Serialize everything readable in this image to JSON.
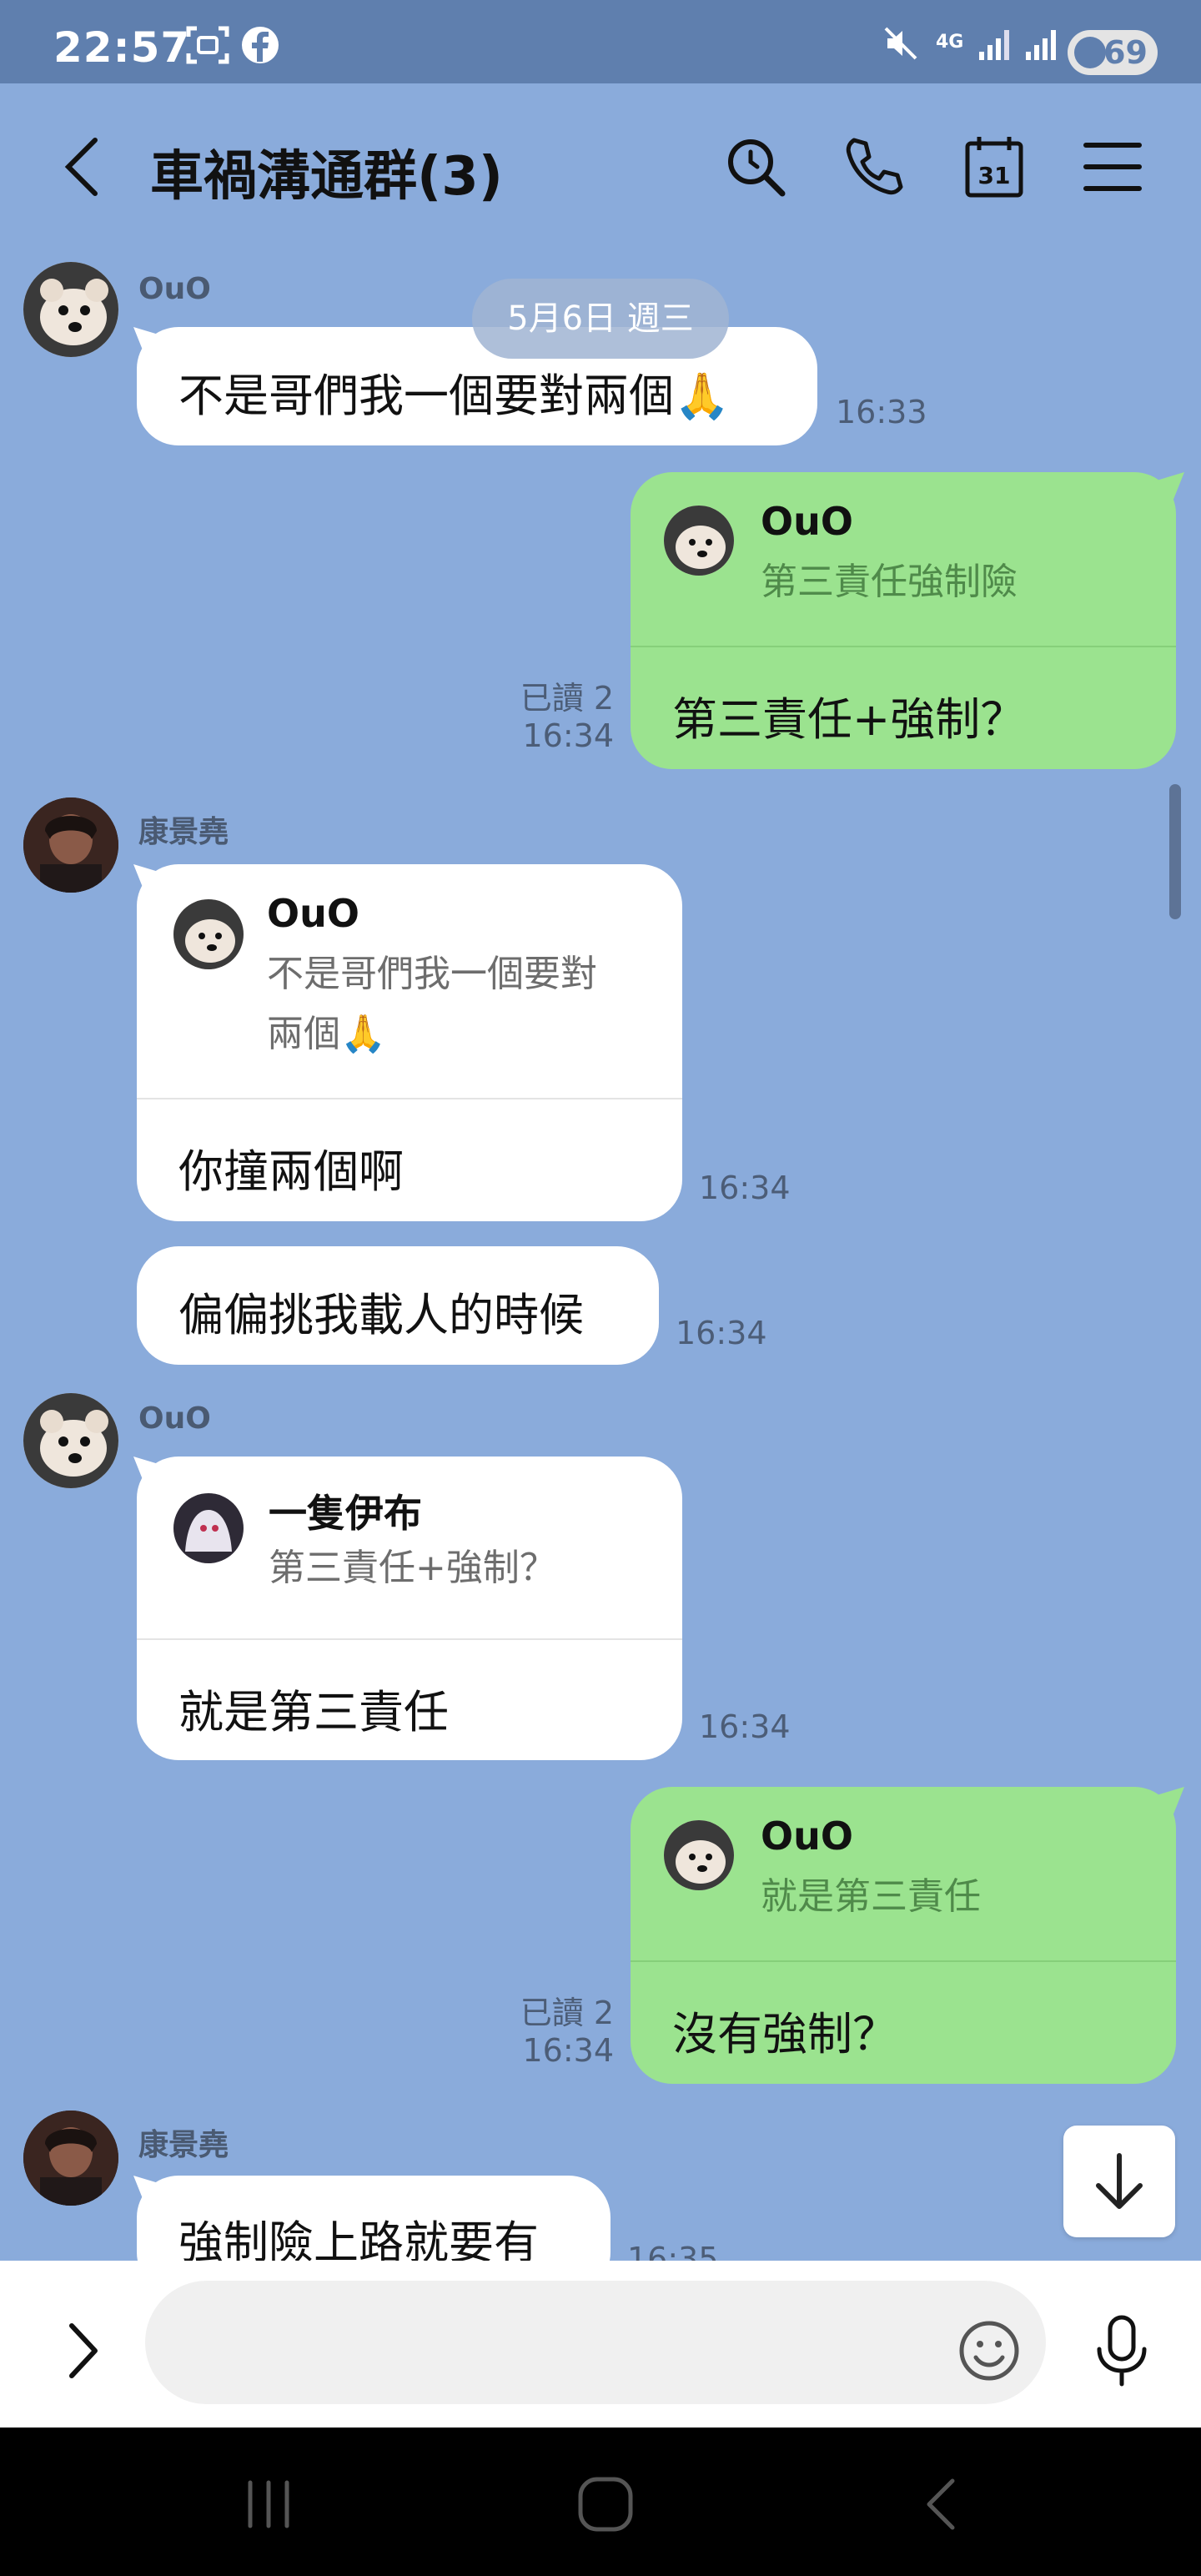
{
  "status_bar": {
    "time": "22:57",
    "network": "4G",
    "battery": "69",
    "icons": [
      "screenshot-icon",
      "facebook-icon",
      "mute-icon",
      "signal-icon",
      "battery-icon"
    ]
  },
  "header": {
    "title": "車禍溝通群(3)",
    "icons": [
      "back-icon",
      "search-icon",
      "call-icon",
      "calendar-icon",
      "menu-icon"
    ],
    "calendar_day": "31"
  },
  "date_chip": "5月6日 週三",
  "messages": [
    {
      "sender": "OuO",
      "text": "不是哥們我一個要對兩個🙏",
      "time": "16:33"
    },
    {
      "side": "right",
      "reply_to": "OuO",
      "reply_quote": "第三責任強制險",
      "text": "第三責任+強制？",
      "read": "已讀 2",
      "time": "16:34"
    },
    {
      "sender": "康景堯",
      "reply_to": "OuO",
      "reply_quote_1": "不是哥們我一個要對",
      "reply_quote_2": "兩個🙏",
      "text": "你撞兩個啊",
      "time": "16:34"
    },
    {
      "text": "偏偏挑我載人的時候",
      "time": "16:34"
    },
    {
      "sender": "OuO",
      "reply_to": "一隻伊布",
      "reply_quote": "第三責任+強制？",
      "text": "就是第三責任",
      "time": "16:34"
    },
    {
      "side": "right",
      "reply_to": "OuO",
      "reply_quote": "就是第三責任",
      "text": "沒有強制？",
      "read": "已讀 2",
      "time": "16:34"
    },
    {
      "sender": "康景堯",
      "text": "強制險上路就要有",
      "time": "16:35"
    }
  ],
  "colors": {
    "chat_background": "#8aabdb",
    "status_bar": "#5f7fae",
    "own_bubble": "#9be38f",
    "other_bubble": "#ffffff"
  },
  "input": {
    "placeholder": ""
  }
}
